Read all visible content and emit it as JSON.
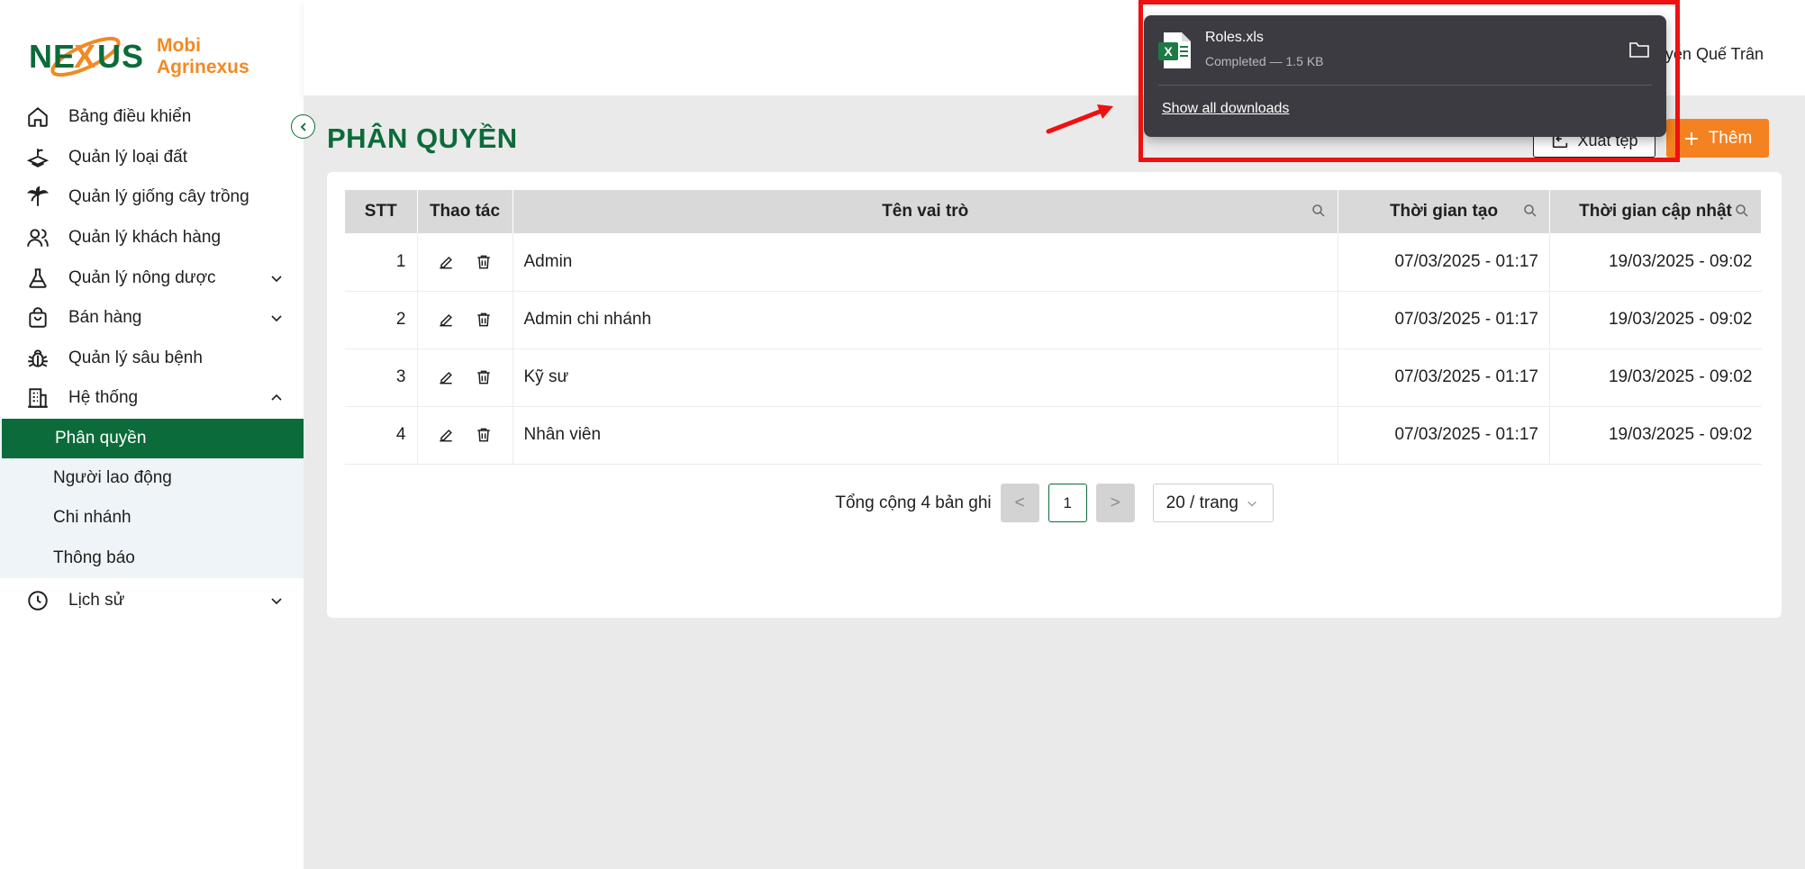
{
  "logo": {
    "mark_text": "NEXUS",
    "brand_line1": "Mobi",
    "brand_line2": "Agrinexus"
  },
  "sidebar": {
    "items": [
      {
        "label": "Bảng điều khiển",
        "icon": "home-icon"
      },
      {
        "label": "Quản lý loại đất",
        "icon": "soil-icon"
      },
      {
        "label": "Quản lý giống cây trồng",
        "icon": "palm-tree-icon"
      },
      {
        "label": "Quản lý khách hàng",
        "icon": "users-icon"
      },
      {
        "label": "Quản lý nông dược",
        "icon": "flask-icon"
      },
      {
        "label": "Bán hàng",
        "icon": "shopping-bag-icon"
      },
      {
        "label": "Quản lý sâu bệnh",
        "icon": "bug-icon"
      },
      {
        "label": "Hệ thống",
        "icon": "building-icon"
      }
    ],
    "sub_items": [
      {
        "label": "Phân quyền",
        "active": true
      },
      {
        "label": "Người lao động",
        "active": false
      },
      {
        "label": "Chi nhánh",
        "active": false
      },
      {
        "label": "Thông báo",
        "active": false
      }
    ],
    "history": {
      "label": "Lịch sử",
      "icon": "clock-history-icon"
    }
  },
  "header": {
    "user_name": "yễn Quế Trân"
  },
  "page": {
    "title": "PHÂN QUYỀN",
    "export_label": "Xuất tệp",
    "add_label": "Thêm"
  },
  "table": {
    "headers": {
      "stt": "STT",
      "actions": "Thao tác",
      "name": "Tên vai trò",
      "created": "Thời gian tạo",
      "updated": "Thời gian cập nhật"
    },
    "rows": [
      {
        "stt": "1",
        "name": "Admin",
        "created": "07/03/2025 - 01:17",
        "updated": "19/03/2025 - 09:02"
      },
      {
        "stt": "2",
        "name": "Admin chi nhánh",
        "created": "07/03/2025 - 01:17",
        "updated": "19/03/2025 - 09:02"
      },
      {
        "stt": "3",
        "name": "Kỹ sư",
        "created": "07/03/2025 - 01:17",
        "updated": "19/03/2025 - 09:02"
      },
      {
        "stt": "4",
        "name": "Nhân viên",
        "created": "07/03/2025 - 01:17",
        "updated": "19/03/2025 - 09:02"
      }
    ]
  },
  "pagination": {
    "total_text": "Tổng cộng 4 bản ghi",
    "current_page": "1",
    "page_size": "20 / trang",
    "prev": "<",
    "next": ">"
  },
  "download": {
    "file_name": "Roles.xls",
    "status": "Completed — 1.5 KB",
    "show_all": "Show all downloads"
  },
  "colors": {
    "brand_green": "#0c6b3a",
    "brand_orange": "#f58220",
    "annotation_red": "#ee1111",
    "popup_bg": "#3c3b42"
  }
}
